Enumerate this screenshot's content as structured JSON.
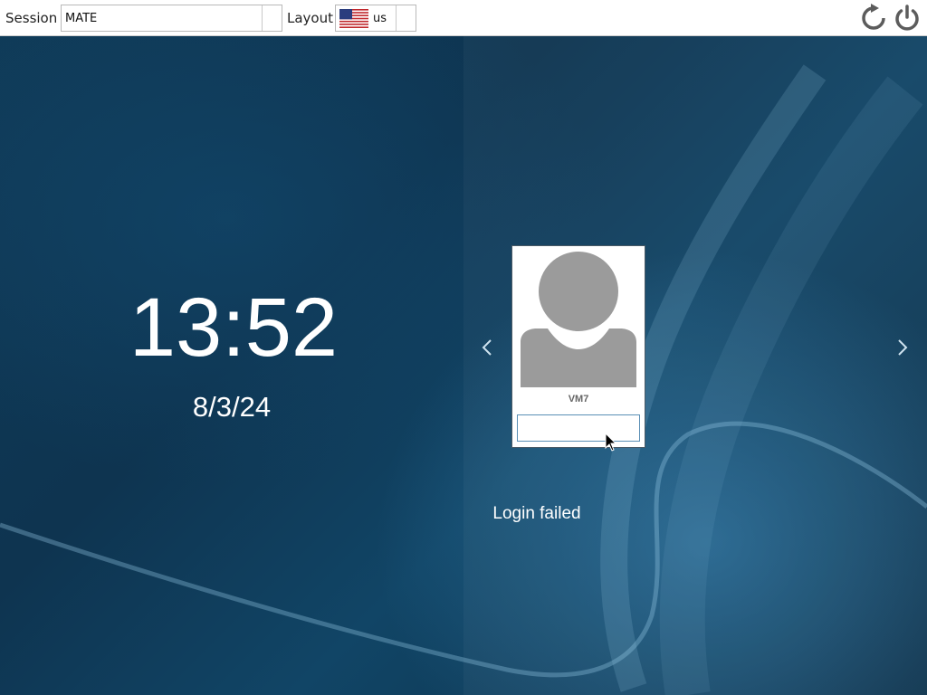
{
  "topbar": {
    "session_label": "Session",
    "session_value": "MATE",
    "layout_label": "Layout",
    "layout_value": "us",
    "layout_flag": "us-flag-icon",
    "restart_icon": "restart-icon",
    "power_icon": "power-icon"
  },
  "clock": {
    "time": "13:52",
    "date": "8/3/24"
  },
  "user": {
    "name": "VM7",
    "avatar_icon": "user-avatar-icon",
    "password_value": ""
  },
  "navigation": {
    "prev_icon": "chevron-left-icon",
    "next_icon": "chevron-right-icon"
  },
  "status": {
    "message": "Login failed"
  },
  "colors": {
    "background": "#0f3a57",
    "topbar": "#ffffff",
    "text_light": "#ffffff",
    "avatar": "#9b9b9b",
    "input_border": "#5a8fb5"
  }
}
